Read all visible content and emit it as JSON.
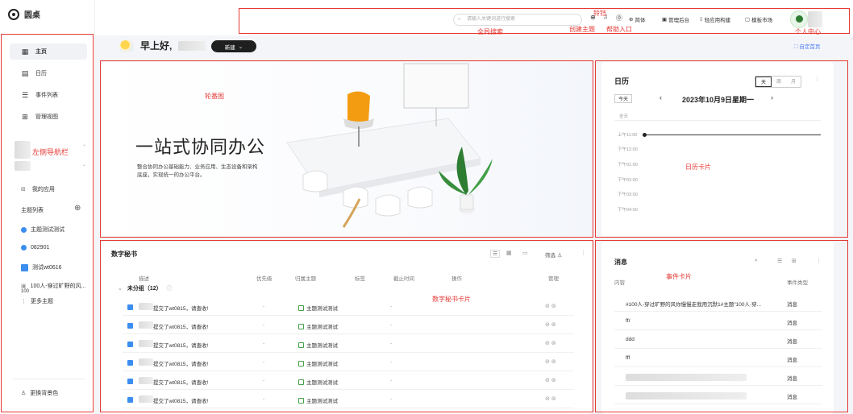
{
  "app": {
    "name": "圆桌"
  },
  "sidebar": {
    "items": [
      {
        "label": "主页",
        "icon": "grid-icon"
      },
      {
        "label": "日历",
        "icon": "calendar-icon"
      },
      {
        "label": "事件列表",
        "icon": "list-icon"
      },
      {
        "label": "管理视图",
        "icon": "view-icon"
      }
    ],
    "my_apps": "我的应用",
    "topic_list": "主题列表",
    "topics": [
      "主题测试测试",
      "082901",
      "测试wt0616",
      "100人-穿过旷野的风...",
      "100"
    ],
    "more_topics": "更多主题",
    "change_bg": "更换背景色"
  },
  "header": {
    "search_placeholder": "请输入关键词进行搜索",
    "language": "简体",
    "admin": "管理后台",
    "light_app": "轻应用构建",
    "template_market": "模板市场"
  },
  "greeting": {
    "text": "早上好,",
    "new_button": "新建",
    "customize": "自定首页"
  },
  "banner": {
    "title": "一站式协同办公",
    "subtitle": "整合协同办公基础能力、业务应用、生态设备和架构底座，实现统一的办公平台。"
  },
  "calendar": {
    "title": "日历",
    "views": [
      "天",
      "周",
      "月"
    ],
    "today": "今天",
    "date": "2023年10月9日星期一",
    "allday": "全天",
    "times": [
      "上午11:00",
      "下午12:00",
      "下午01:00",
      "下午02:00",
      "下午03:00",
      "下午04:00"
    ]
  },
  "secretary": {
    "title": "数字秘书",
    "filter": "筛选",
    "columns": [
      "描述",
      "优先级",
      "归属主题",
      "标签",
      "截止时间",
      "操作",
      "管理"
    ],
    "group": "未分组（12）",
    "rows": [
      {
        "desc": "提交了wt0815，请查收!",
        "priority": "-",
        "topic": "主题测试测试",
        "deadline": "-"
      },
      {
        "desc": "提交了wt0815，请查收!",
        "priority": "-",
        "topic": "主题测试测试",
        "deadline": "-"
      },
      {
        "desc": "提交了wt0815，请查收!",
        "priority": "-",
        "topic": "主题测试测试",
        "deadline": "-"
      },
      {
        "desc": "提交了wt0815，请查收!",
        "priority": "-",
        "topic": "主题测试测试",
        "deadline": "-"
      },
      {
        "desc": "提交了wt0815，请查收!",
        "priority": "-",
        "topic": "主题测试测试",
        "deadline": "-"
      },
      {
        "desc": "提交了wt0815，请查收!",
        "priority": "-",
        "topic": "主题测试测试",
        "deadline": "-"
      }
    ]
  },
  "messages": {
    "title": "消息",
    "columns": [
      "内容",
      "事件类型"
    ],
    "rows": [
      {
        "content": "#100人-穿过旷野的风你慢慢走我用沉默1#主题\"100人-穿...",
        "type": "消息"
      },
      {
        "content": "ffr",
        "type": "消息"
      },
      {
        "content": "ddd",
        "type": "消息"
      },
      {
        "content": "fff",
        "type": "消息"
      },
      {
        "content": "",
        "type": "消息"
      },
      {
        "content": "",
        "type": "消息"
      }
    ]
  },
  "annotations": {
    "nav": "左侧导航栏",
    "bell": "铃铛",
    "search": "全局搜索",
    "create": "创建主题",
    "help": "帮助入口",
    "profile": "个人中心",
    "carousel": "轮番图",
    "calendar_card": "日历卡片",
    "secretary_card": "数字秘书卡片",
    "event_card": "事件卡片"
  },
  "colors": {
    "accent": "#4a7cf6",
    "annotation": "#e53935",
    "dark": "#1f1f1f"
  }
}
